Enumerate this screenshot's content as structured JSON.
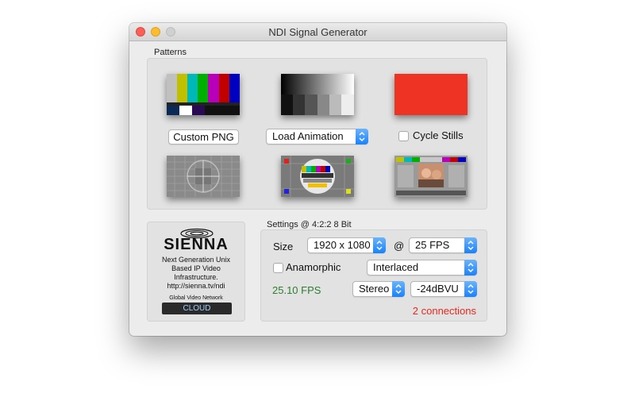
{
  "window": {
    "title": "NDI Signal Generator"
  },
  "patterns": {
    "label": "Patterns",
    "custom_png_label": "Custom PNG",
    "load_animation_label": "Load Animation",
    "cycle_stills_label": "Cycle Stills",
    "thumbnails": [
      "color-bars",
      "grayscale-ramp",
      "red-solid",
      "gray-test-card",
      "color-test-card",
      "photo-test-card"
    ]
  },
  "settings": {
    "label": "Settings @ 4:2:2 8 Bit",
    "size_label": "Size",
    "size_value": "1920 x 1080",
    "at_label": "@",
    "fps_value": "25 FPS",
    "anamorphic_label": "Anamorphic",
    "scan_value": "Interlaced",
    "fps_readout": "25.10 FPS",
    "audio_value": "Stereo",
    "level_value": "-24dBVU",
    "connections": "2 connections"
  },
  "sienna": {
    "logo": "SIENNA",
    "line1": "Next Generation Unix",
    "line2": "Based IP Video",
    "line3": "Infrastructure.",
    "url": "http://sienna.tv/ndi",
    "network_label": "Global Video Network",
    "cloud_label": "CLOUD"
  },
  "colors": {
    "fps_readout": "#2e7d32",
    "connections": "#e8281e",
    "stepper": "#1a82fb",
    "red_pattern": "#ee3224"
  }
}
